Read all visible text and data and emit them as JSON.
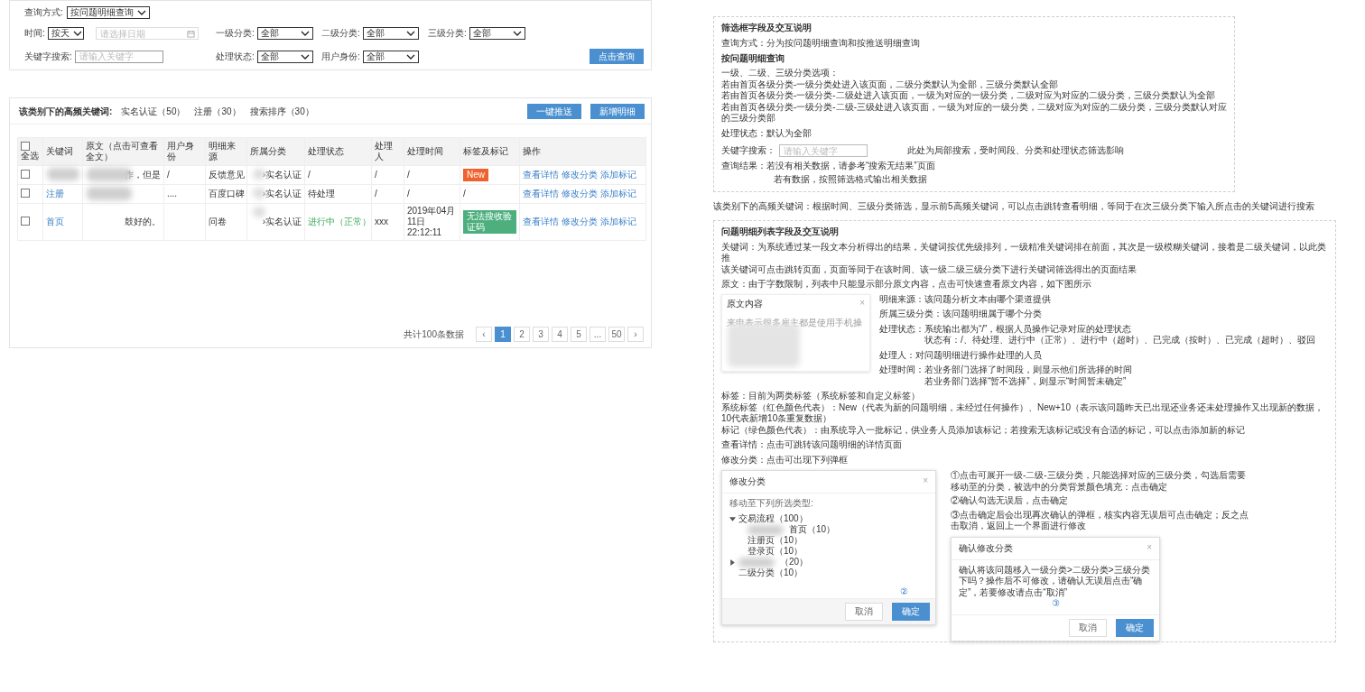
{
  "filter_panel": {
    "query_mode": {
      "label": "查询方式:",
      "value": "按问题明细查询"
    },
    "time": {
      "label": "时间:",
      "value": "按天",
      "date_placeholder": "请选择日期"
    },
    "selects": [
      {
        "label": "一级分类:",
        "value": "全部"
      },
      {
        "label": "二级分类:",
        "value": "全部"
      },
      {
        "label": "三级分类:",
        "value": "全部"
      }
    ],
    "keyword": {
      "label": "关键字搜索:",
      "placeholder": "请输入关键字"
    },
    "selects_2": [
      {
        "label": "处理状态:",
        "value": "全部"
      },
      {
        "label": "用户身份:",
        "value": "全部"
      }
    ],
    "search_button": "点击查询"
  },
  "keyword_panel": {
    "title": "该类别下的高频关键词:",
    "keywords": [
      "实名认证（50）",
      "注册（30）",
      "搜索排序（30）"
    ],
    "buttons": [
      "一键推送",
      "新增明细"
    ]
  },
  "table": {
    "select_all": {
      "label": "全选",
      "checked": false
    },
    "columns": [
      "关键词",
      "原文（点击可查看全文）",
      "用户身份",
      "明细来源",
      "所属分类",
      "处理状态",
      "处理人",
      "处理时间",
      "标签及标记",
      "操作"
    ],
    "rows": [
      {
        "checked": false,
        "keyword": {
          "redacted": true
        },
        "text": {
          "text": "作，但是",
          "redacted": true
        },
        "user": "/",
        "source": "反馈意见",
        "category": {
          "text": "›实名认证",
          "redacted": true
        },
        "status": {
          "text": "/",
          "kind": "plain"
        },
        "handler": "/",
        "time": "/",
        "tag": {
          "kind": "badge",
          "text": "New",
          "color": "#f0622d"
        },
        "actions": [
          "查看详情",
          "修改分类",
          "添加标记"
        ]
      },
      {
        "checked": false,
        "keyword": {
          "text": "注册"
        },
        "text": {
          "redacted": true
        },
        "user": "....",
        "source": "百度口碑",
        "category": {
          "text": "›实名认证",
          "redacted": true
        },
        "status": {
          "text": "待处理",
          "kind": "plain"
        },
        "handler": "/",
        "time": "/",
        "tag": {
          "kind": "plain",
          "text": "/"
        },
        "actions": [
          "查看详情",
          "修改分类",
          "添加标记"
        ]
      },
      {
        "checked": false,
        "keyword": {
          "text": "首页"
        },
        "text": {
          "text": "鼓好的。"
        },
        "source": "问卷",
        "category": {
          "text": "›实名认证",
          "redacted": true
        },
        "status": {
          "text": "进行中（正常）",
          "kind": "active"
        },
        "handler": "xxx",
        "time": "2019年04月11日 22:12:11",
        "tag": {
          "kind": "badge",
          "text": "无法搜收验证码",
          "color": "#4caf7d"
        },
        "actions": [
          "查看详情",
          "修改分类",
          "添加标记"
        ]
      }
    ]
  },
  "pagination": {
    "total": "共计100条数据",
    "pages": [
      {
        "label": "‹",
        "selected": false
      },
      {
        "label": "1",
        "selected": true
      },
      {
        "label": "2",
        "selected": false
      },
      {
        "label": "3",
        "selected": false
      },
      {
        "label": "4",
        "selected": false
      },
      {
        "label": "5",
        "selected": false
      },
      {
        "label": "...",
        "selected": false
      },
      {
        "label": "50",
        "selected": false
      },
      {
        "label": "›",
        "selected": false
      }
    ]
  },
  "filter_notes": {
    "title": "筛选框字段及交互说明",
    "items": [
      {
        "kind": "text",
        "text": "查询方式：分为按问题明细查询和按推送明细查询"
      },
      {
        "kind": "heading",
        "text": "按问题明细查询"
      },
      {
        "kind": "text",
        "text": "一级、二级、三级分类选项："
      },
      {
        "kind": "tight",
        "text": "若由首页各级分类-一级分类处进入该页面，二级分类默认为全部，三级分类默认全部"
      },
      {
        "kind": "tight",
        "text": "若由首页各级分类-一级分类-二级处进入该页面，一级为对应的一级分类，二级对应为对应的二级分类，三级分类默认为全部"
      },
      {
        "kind": "tight",
        "text": "若由首页各级分类-一级分类-二级-三级处进入该页面，一级为对应的一级分类，二级对应为对应的二级分类，三级分类默认对应的三级分类部"
      },
      {
        "kind": "text",
        "text": "处理状态：默认为全部"
      },
      {
        "kind": "search",
        "label": "关键字搜索：",
        "placeholder": "请输入关键字",
        "note": "此处为局部搜索，受时间段、分类和处理状态筛选影响"
      },
      {
        "kind": "text",
        "text": "查询结果：若没有相关数据，请参考“搜索无结果”页面"
      },
      {
        "kind": "indent",
        "text": "若有数据，按照筛选格式输出相关数据"
      }
    ]
  },
  "keyword_note": "该类别下的高频关键词：根据时间、三级分类筛选，显示前5高频关键词，可以点击跳转查看明细，等同于在次三级分类下输入所点击的关键词进行搜索",
  "list_notes": {
    "title": "问题明细列表字段及交互说明",
    "items": [
      {
        "kind": "text",
        "text": "关键词：为系统通过某一段文本分析得出的结果，关键词按优先级排列，一级精准关键词排在前面，其次是一级模糊关键词，接着是二级关键词，以此类推"
      },
      {
        "kind": "tight",
        "text": "该关键词可点击跳转页面，页面等同于在该时间、该一级二级三级分类下进行关键词筛选得出的页面结果"
      },
      {
        "kind": "text",
        "text": "原文：由于字数限制，列表中只能显示部分原文内容，点击可快速查看原文内容，如下图所示"
      },
      {
        "kind": "popup",
        "title": "原文内容",
        "close": "×",
        "lines": [
          "来电表示很多雇主都是使用手机操"
        ],
        "redacted": true,
        "beside": [
          {
            "kind": "text",
            "text": "明细来源：该问题分析文本由哪个渠道提供"
          },
          {
            "kind": "text",
            "text": "所属三级分类：该问题明细属于哪个分类"
          },
          {
            "kind": "text",
            "text": "处理状态：系统输出都为“/”，根据人员操作记录对应的处理状态"
          },
          {
            "kind": "indent",
            "text": "状态有：/、待处理、进行中（正常）、进行中（超时）、已完成（按时）、已完成（超时）、驳回"
          },
          {
            "kind": "text",
            "text": "处理人：对问题明细进行操作处理的人员"
          },
          {
            "kind": "text",
            "text": "处理时间：若业务部门选择了时间段，则显示他们所选择的时间"
          },
          {
            "kind": "indent",
            "text": "若业务部门选择“暂不选择”，则显示“时间暂未确定”"
          }
        ]
      },
      {
        "kind": "text",
        "text": "标签：目前为两类标签（系统标签和自定义标签）"
      },
      {
        "kind": "tight",
        "text": "系统标签（红色颜色代表）：New（代表为新的问题明细，未经过任何操作）、New+10（表示该问题昨天已出现还业务还未处理操作又出现新的数据，10代表新增10条重复数据）"
      },
      {
        "kind": "tight",
        "text": "标记（绿色颜色代表）：由系统导入一批标记，供业务人员添加该标记；若搜索无该标记或没有合适的标记，可以点击添加新的标记"
      },
      {
        "kind": "text",
        "text": "查看详情：点击可跳转该问题明细的详情页面"
      },
      {
        "kind": "text",
        "text": "修改分类：点击可出现下列弹框"
      }
    ],
    "move_dialog": {
      "title": "修改分类",
      "close": "×",
      "label": "移动至下列所选类型:",
      "tree": [
        {
          "label": "交易流程（100）",
          "expanded": true,
          "children": [
            {
              "label": "首页（10）",
              "redacted": true
            },
            {
              "label": "注册页（10）"
            },
            {
              "label": "登录页（10）"
            }
          ]
        },
        {
          "label": "（20）",
          "expanded": false,
          "redacted": true
        },
        {
          "label": "二级分类（10）"
        }
      ],
      "marker": "②",
      "buttons": [
        "取消",
        "确定"
      ]
    },
    "annotations": [
      "①点击可展开一级-二级-三级分类，只能选择对应的三级分类，勾选后需要移动至的分类，被选中的分类背景颜色填充：点击确定",
      "②确认勾选无误后，点击确定",
      "③点击确定后会出现再次确认的弹框，核实内容无误后可点击确定；反之点击取消，返回上一个界面进行修改"
    ],
    "confirm_dialog": {
      "title": "确认修改分类",
      "close": "×",
      "text": "确认将该问题移入一级分类>二级分类>三级分类下吗？操作后不可修改，请确认无误后点击“确定”，若要修改请点击“取消”",
      "marker": "③",
      "buttons": [
        "取消",
        "确定"
      ]
    }
  }
}
